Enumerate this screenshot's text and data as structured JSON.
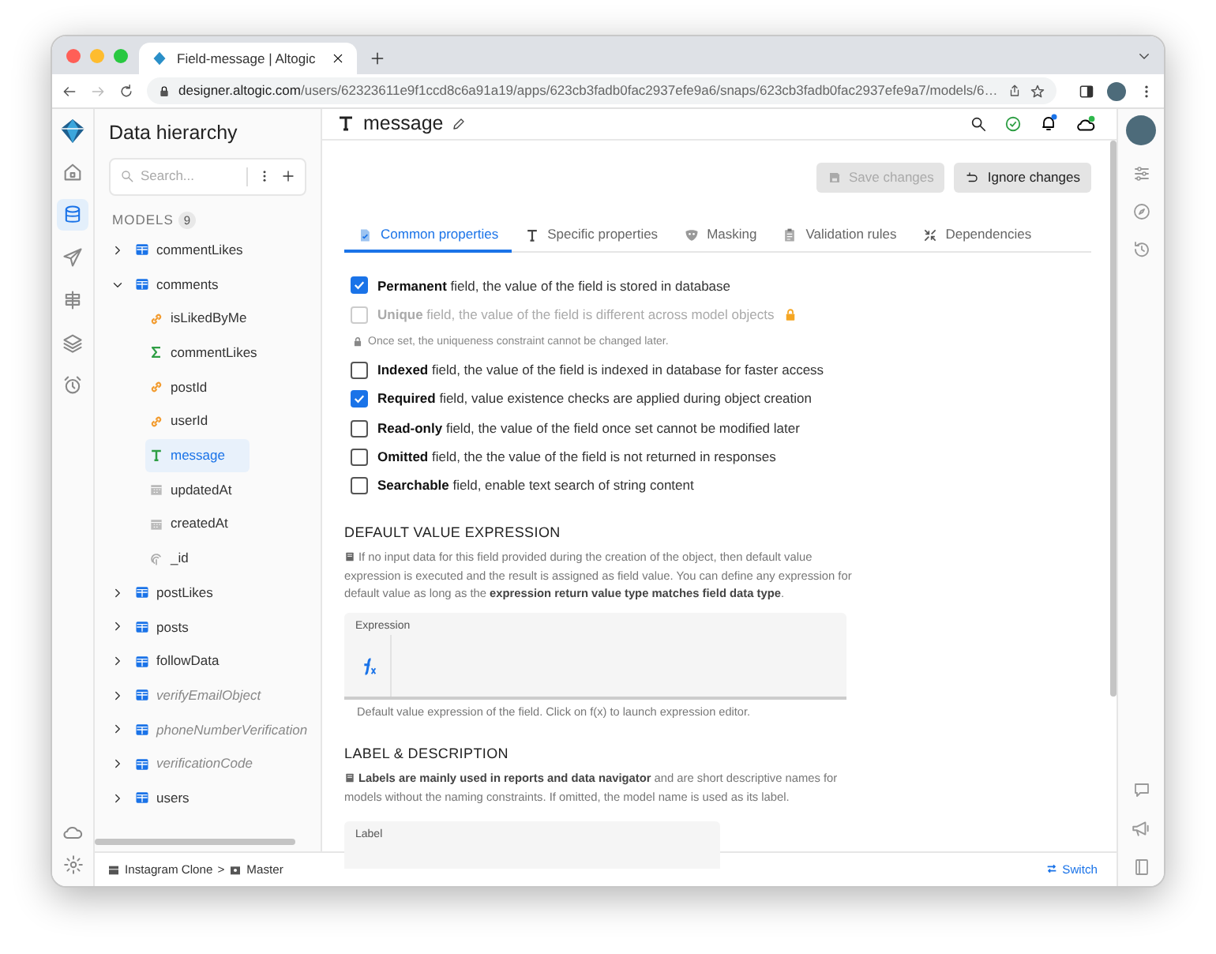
{
  "browser": {
    "tab_title": "Field-message | Altogic",
    "url_host": "designer.altogic.com",
    "url_path": "/users/62323611e9f1ccd8c6a91a19/apps/623cb3fadb0fac2937efe9a6/snaps/623cb3fadb0fac2937efe9a7/models/6…"
  },
  "rail": {
    "items": [
      {
        "kind": "home",
        "selected": false
      },
      {
        "kind": "database",
        "selected": true
      },
      {
        "kind": "send",
        "selected": false
      },
      {
        "kind": "signpost",
        "selected": false
      },
      {
        "kind": "layers",
        "selected": false
      },
      {
        "kind": "alarm",
        "selected": false
      }
    ]
  },
  "sidebar": {
    "title": "Data hierarchy",
    "search": {
      "placeholder": "Search..."
    },
    "models_label": "MODELS",
    "models_count": "9",
    "tree": [
      {
        "name": "commentLikes",
        "muted": false,
        "expanded": false
      },
      {
        "name": "comments",
        "muted": false,
        "expanded": true,
        "children": [
          {
            "name": "isLikedByMe",
            "kind": "link",
            "selected": false
          },
          {
            "name": "commentLikes",
            "kind": "sum",
            "selected": false
          },
          {
            "name": "postId",
            "kind": "link",
            "selected": false
          },
          {
            "name": "userId",
            "kind": "link",
            "selected": false
          },
          {
            "name": "message",
            "kind": "text",
            "selected": true
          },
          {
            "name": "updatedAt",
            "kind": "date",
            "selected": false
          },
          {
            "name": "createdAt",
            "kind": "date",
            "selected": false
          },
          {
            "name": "_id",
            "kind": "id",
            "selected": false
          }
        ]
      },
      {
        "name": "postLikes",
        "muted": false,
        "expanded": false
      },
      {
        "name": "posts",
        "muted": false,
        "expanded": false
      },
      {
        "name": "followData",
        "muted": false,
        "expanded": false
      },
      {
        "name": "verifyEmailObject",
        "muted": true,
        "expanded": false
      },
      {
        "name": "phoneNumberVerification",
        "muted": true,
        "expanded": false
      },
      {
        "name": "verificationCode",
        "muted": true,
        "expanded": false
      },
      {
        "name": "users",
        "muted": false,
        "expanded": false
      }
    ]
  },
  "header": {
    "title": "message"
  },
  "actions": [
    {
      "kind": "save",
      "label": "Save changes",
      "disabled": true
    },
    {
      "kind": "undo",
      "label": "Ignore changes",
      "disabled": false
    }
  ],
  "tabs": [
    {
      "kind": "doc",
      "label": "Common properties",
      "selected": true
    },
    {
      "kind": "text",
      "label": "Specific properties",
      "selected": false
    },
    {
      "kind": "mask",
      "label": "Masking",
      "selected": false
    },
    {
      "kind": "clipboard",
      "label": "Validation rules",
      "selected": false
    },
    {
      "kind": "arrows",
      "label": "Dependencies",
      "selected": false
    }
  ],
  "options": [
    {
      "text": "**Permanent** field, the value of the field is stored in database",
      "checked": true,
      "disabled": false
    },
    {
      "text": "**Unique** field, the value of the field is different across model objects",
      "checked": false,
      "disabled": true,
      "locked": true,
      "note": "Once set, the uniqueness constraint cannot be changed later."
    },
    {
      "text": "**Indexed** field, the value of the field is indexed in database for faster access",
      "checked": false,
      "disabled": false
    },
    {
      "text": "**Required** field, value existence checks are applied during object creation",
      "checked": true,
      "disabled": false
    },
    {
      "text": "**Read-only** field, the value of the field once set cannot be modified later",
      "checked": false,
      "disabled": false
    },
    {
      "text": "**Omitted** field, the the value of the field is not returned in responses",
      "checked": false,
      "disabled": false
    },
    {
      "text": "**Searchable** field, enable text search of string content",
      "checked": false,
      "disabled": false
    }
  ],
  "default_value": {
    "title": "DEFAULT VALUE EXPRESSION",
    "text": "If no input data for this field provided during the creation of the object, then default value expression is executed and the result is assigned as field value. You can define any expression for default value as long as the **expression return value type matches field data type**.",
    "field_label": "Expression",
    "hint": "Default value expression of the field. Click on f(x) to launch expression editor."
  },
  "label_section": {
    "title": "LABEL & DESCRIPTION",
    "text": "**Labels are mainly used in reports and data navigator** and are short descriptive names for models without the naming constraints. If omitted, the model name is used as its label.",
    "field_label": "Label"
  },
  "footer": {
    "app": "Instagram Clone",
    "separator": ">",
    "branch": "Master",
    "switch": "Switch"
  }
}
